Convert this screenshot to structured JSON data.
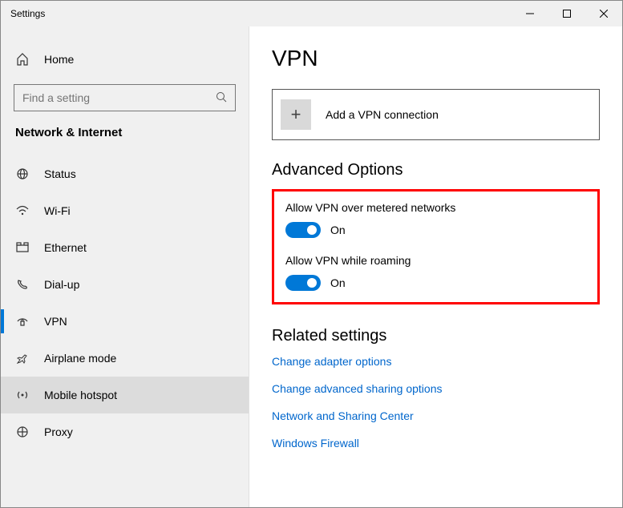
{
  "title": "Settings",
  "home_label": "Home",
  "search_placeholder": "Find a setting",
  "section_label": "Network & Internet",
  "nav": [
    {
      "label": "Status"
    },
    {
      "label": "Wi-Fi"
    },
    {
      "label": "Ethernet"
    },
    {
      "label": "Dial-up"
    },
    {
      "label": "VPN"
    },
    {
      "label": "Airplane mode"
    },
    {
      "label": "Mobile hotspot"
    },
    {
      "label": "Proxy"
    }
  ],
  "page": {
    "title": "VPN",
    "add_label": "Add a VPN connection",
    "advanced_title": "Advanced Options",
    "metered": {
      "label": "Allow VPN over metered networks",
      "state": "On"
    },
    "roaming": {
      "label": "Allow VPN while roaming",
      "state": "On"
    },
    "related_title": "Related settings",
    "links": [
      "Change adapter options",
      "Change advanced sharing options",
      "Network and Sharing Center",
      "Windows Firewall"
    ]
  }
}
